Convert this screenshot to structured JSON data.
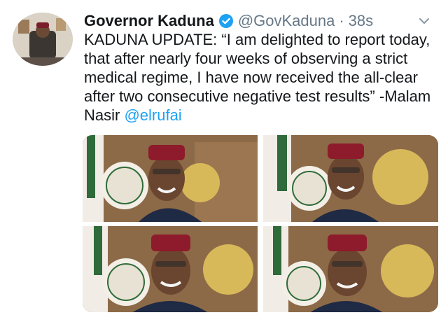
{
  "tweet": {
    "display_name": "Governor Kaduna",
    "handle": "@GovKaduna",
    "separator": "·",
    "time": "38s",
    "text_main": "KADUNA UPDATE: “I am delighted to report today, that after nearly four weeks of observing a strict medical regime, I have now received the all-clear after two consecutive negative test results” -Malam Nasir ",
    "mention": "@elrufai",
    "media_count": 4
  },
  "icons": {
    "verified": "verified-badge-icon",
    "caret": "chevron-down-icon"
  },
  "colors": {
    "accent": "#1da1f2",
    "secondary_text": "#657786",
    "primary_text": "#14171a"
  }
}
